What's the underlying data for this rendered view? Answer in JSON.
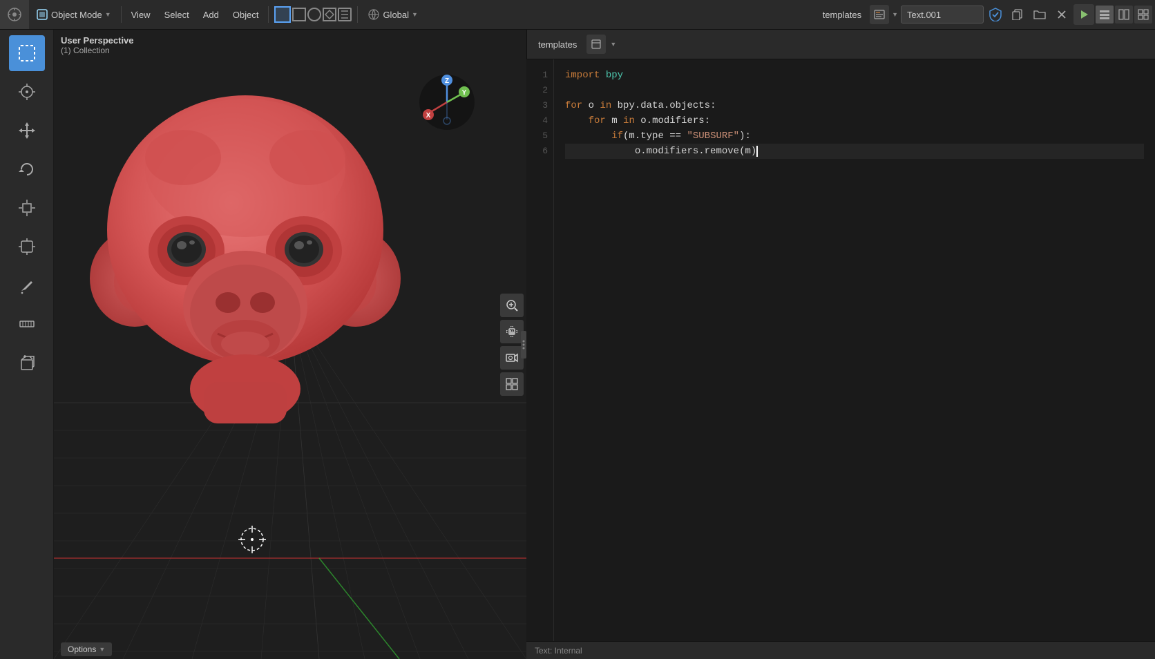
{
  "header": {
    "workspace_icon": "⊕",
    "mode_label": "Object Mode",
    "view_label": "View",
    "select_label": "Select",
    "add_label": "Add",
    "object_label": "Object",
    "global_label": "Global",
    "templates_label": "templates",
    "text_name": "Text.001",
    "play_icon": "▶",
    "sync_icon": "⧖"
  },
  "viewport": {
    "perspective_label": "User Perspective",
    "collection_label": "(1) Collection",
    "options_label": "Options",
    "status_label": "Text: Internal"
  },
  "toolbar": {
    "tools": [
      {
        "name": "select-tool",
        "icon": "⊡",
        "active": true
      },
      {
        "name": "cursor-tool",
        "icon": "⊕",
        "active": false
      },
      {
        "name": "move-tool",
        "icon": "✛",
        "active": false
      },
      {
        "name": "rotate-tool",
        "icon": "↻",
        "active": false
      },
      {
        "name": "scale-tool",
        "icon": "⤢",
        "active": false
      },
      {
        "name": "transform-tool",
        "icon": "⊕",
        "active": false
      },
      {
        "name": "annotate-tool",
        "icon": "✏",
        "active": false
      },
      {
        "name": "measure-tool",
        "icon": "📏",
        "active": false
      },
      {
        "name": "add-cube-tool",
        "icon": "⊞",
        "active": false
      }
    ]
  },
  "code": {
    "lines": [
      {
        "num": 1,
        "tokens": [
          {
            "type": "kw",
            "text": "import"
          },
          {
            "type": "space",
            "text": " "
          },
          {
            "type": "module",
            "text": "bpy"
          }
        ]
      },
      {
        "num": 2,
        "tokens": []
      },
      {
        "num": 3,
        "tokens": [
          {
            "type": "kw",
            "text": "for"
          },
          {
            "type": "space",
            "text": " "
          },
          {
            "type": "var-white",
            "text": "o"
          },
          {
            "type": "space",
            "text": " "
          },
          {
            "type": "kw",
            "text": "in"
          },
          {
            "type": "space",
            "text": " "
          },
          {
            "type": "var-white",
            "text": "bpy.data.objects:"
          }
        ]
      },
      {
        "num": 4,
        "tokens": [
          {
            "type": "space",
            "text": "    "
          },
          {
            "type": "kw",
            "text": "for"
          },
          {
            "type": "space",
            "text": " "
          },
          {
            "type": "var-white",
            "text": "m"
          },
          {
            "type": "space",
            "text": " "
          },
          {
            "type": "kw",
            "text": "in"
          },
          {
            "type": "space",
            "text": " "
          },
          {
            "type": "var-white",
            "text": "o.modifiers:"
          }
        ]
      },
      {
        "num": 5,
        "tokens": [
          {
            "type": "space",
            "text": "        "
          },
          {
            "type": "kw",
            "text": "if"
          },
          {
            "type": "punct",
            "text": "("
          },
          {
            "type": "var-white",
            "text": "m.type"
          },
          {
            "type": "space",
            "text": " "
          },
          {
            "type": "punct",
            "text": "=="
          },
          {
            "type": "space",
            "text": " "
          },
          {
            "type": "str",
            "text": "\"SUBSURF\""
          },
          {
            "type": "punct",
            "text": "):"
          }
        ]
      },
      {
        "num": 6,
        "tokens": [
          {
            "type": "space",
            "text": "            "
          },
          {
            "type": "var-white",
            "text": "o.modifiers.remove"
          },
          {
            "type": "punct",
            "text": "("
          },
          {
            "type": "var-white",
            "text": "m"
          },
          {
            "type": "punct",
            "text": ")"
          }
        ],
        "cursor": true
      }
    ]
  },
  "axis": {
    "x_color": "#e05050",
    "y_color": "#70c050",
    "z_color": "#5090e0"
  }
}
